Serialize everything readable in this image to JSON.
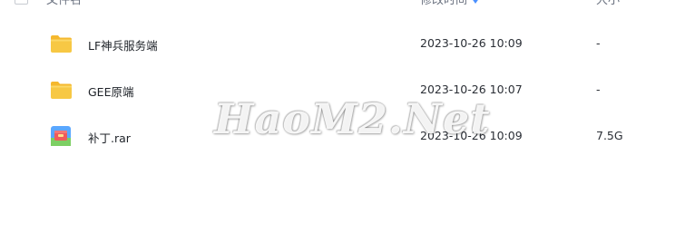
{
  "header": {
    "name_label": "文件名",
    "time_label": "修改时间",
    "size_label": "大小"
  },
  "files": [
    {
      "name": "LF神兵服务端",
      "modified": "2023-10-26 10:09",
      "size": "-",
      "icon": "folder-icon"
    },
    {
      "name": "GEE原端",
      "modified": "2023-10-26 10:07",
      "size": "-",
      "icon": "folder-icon"
    },
    {
      "name": "补丁.rar",
      "modified": "2023-10-26 10:09",
      "size": "7.5G",
      "icon": "rar-archive-icon"
    }
  ],
  "watermark": "HaoM2.Net",
  "colors": {
    "folder": "#f7c844",
    "folder_tab": "#f5b82e",
    "sort_accent": "#4a90ff",
    "rar_blue": "#5aa7ff",
    "rar_green": "#7ccf63",
    "rar_red": "#ef5b5b"
  }
}
